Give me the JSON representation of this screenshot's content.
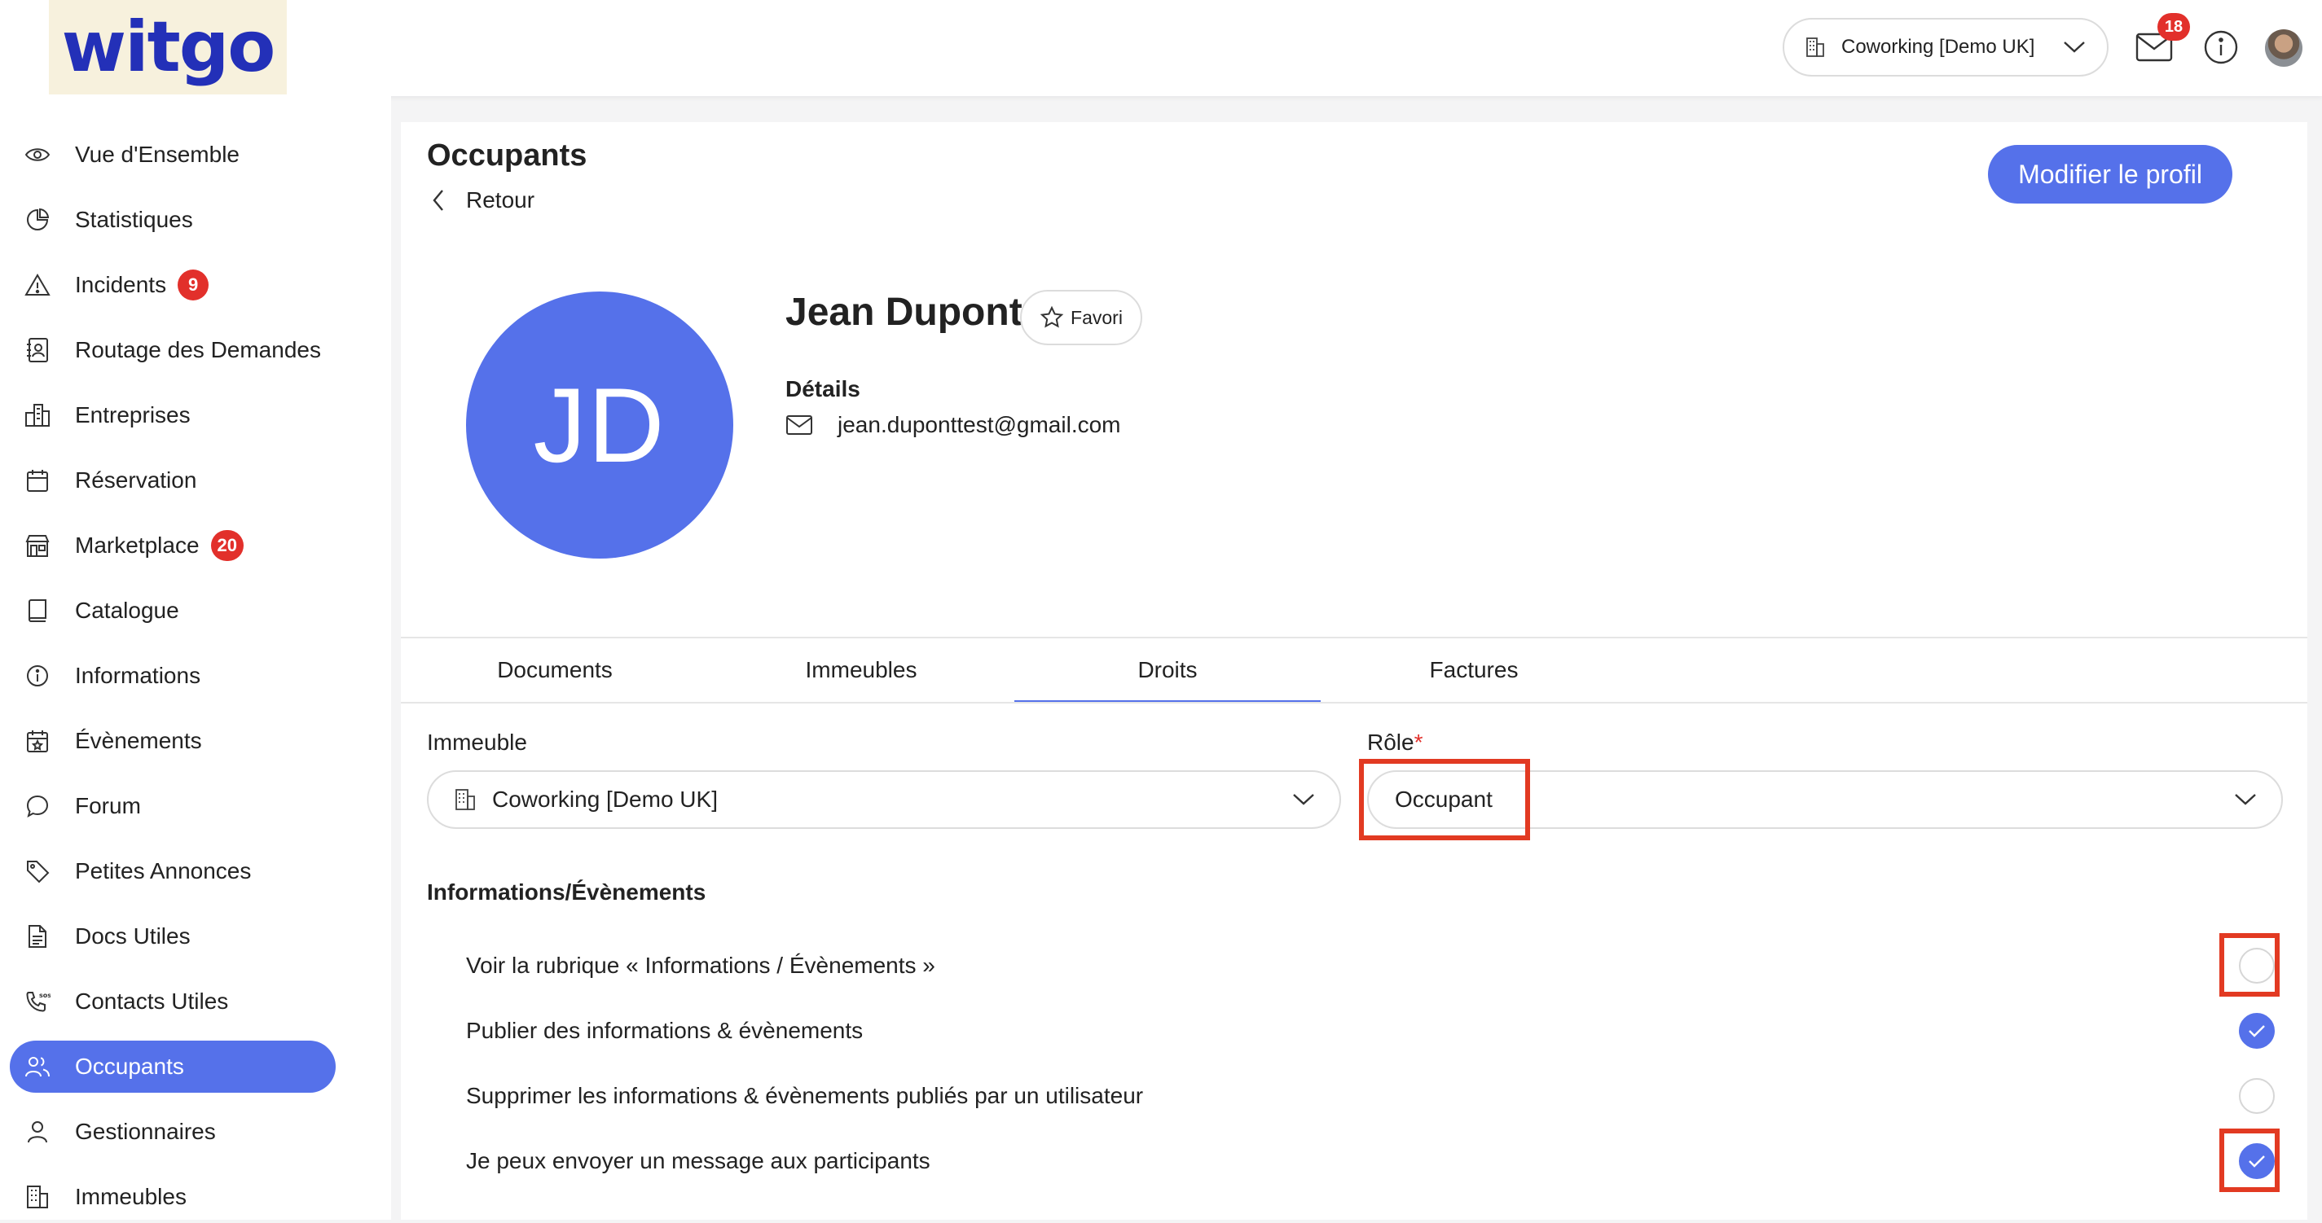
{
  "topbar": {
    "logo": "witgo",
    "building_select": "Coworking [Demo UK]",
    "mail_badge": "18",
    "icons": [
      "building-icon",
      "chevron-down-icon",
      "mail-icon",
      "info-icon",
      "user-avatar"
    ]
  },
  "sidebar": {
    "items": [
      {
        "label": "Vue d'Ensemble",
        "icon": "eye-icon"
      },
      {
        "label": "Statistiques",
        "icon": "pie-chart-icon"
      },
      {
        "label": "Incidents",
        "icon": "warning-icon",
        "badge": "9"
      },
      {
        "label": "Routage des Demandes",
        "icon": "contact-book-icon"
      },
      {
        "label": "Entreprises",
        "icon": "buildings-icon"
      },
      {
        "label": "Réservation",
        "icon": "calendar-icon"
      },
      {
        "label": "Marketplace",
        "icon": "store-icon",
        "badge": "20"
      },
      {
        "label": "Catalogue",
        "icon": "book-icon"
      },
      {
        "label": "Informations",
        "icon": "info-icon"
      },
      {
        "label": "Évènements",
        "icon": "calendar-star-icon"
      },
      {
        "label": "Forum",
        "icon": "chat-icon"
      },
      {
        "label": "Petites Annonces",
        "icon": "tag-icon"
      },
      {
        "label": "Docs Utiles",
        "icon": "document-icon"
      },
      {
        "label": "Contacts Utiles",
        "icon": "phone-sos-icon"
      },
      {
        "label": "Occupants",
        "icon": "users-icon",
        "active": true
      },
      {
        "label": "Gestionnaires",
        "icon": "user-icon"
      },
      {
        "label": "Immeubles",
        "icon": "building-icon"
      }
    ]
  },
  "main": {
    "title": "Occupants",
    "back": "Retour",
    "edit_button": "Modifier le profil",
    "avatar_initials": "JD",
    "name": "Jean Dupont",
    "favorite": "Favori",
    "details_label": "Détails",
    "email": "jean.duponttest@gmail.com",
    "tabs": [
      "Documents",
      "Immeubles",
      "Droits",
      "Factures"
    ],
    "active_tab": "Droits",
    "building_label": "Immeuble",
    "building_value": "Coworking [Demo UK]",
    "role_label": "Rôle",
    "role_required": "*",
    "role_value": "Occupant",
    "section_title": "Informations/Évènements",
    "permissions": [
      {
        "label": "Voir la rubrique « Informations / Évènements »",
        "checked": false
      },
      {
        "label": "Publier des informations & évènements",
        "checked": true
      },
      {
        "label": "Supprimer les informations & évènements publiés par un utilisateur",
        "checked": false
      },
      {
        "label": "Je peux envoyer un message aux participants",
        "checked": true
      }
    ]
  },
  "colors": {
    "accent": "#5571ea",
    "badge": "#e2302b",
    "highlight": "#e23a22",
    "logo": "#2330b8"
  }
}
